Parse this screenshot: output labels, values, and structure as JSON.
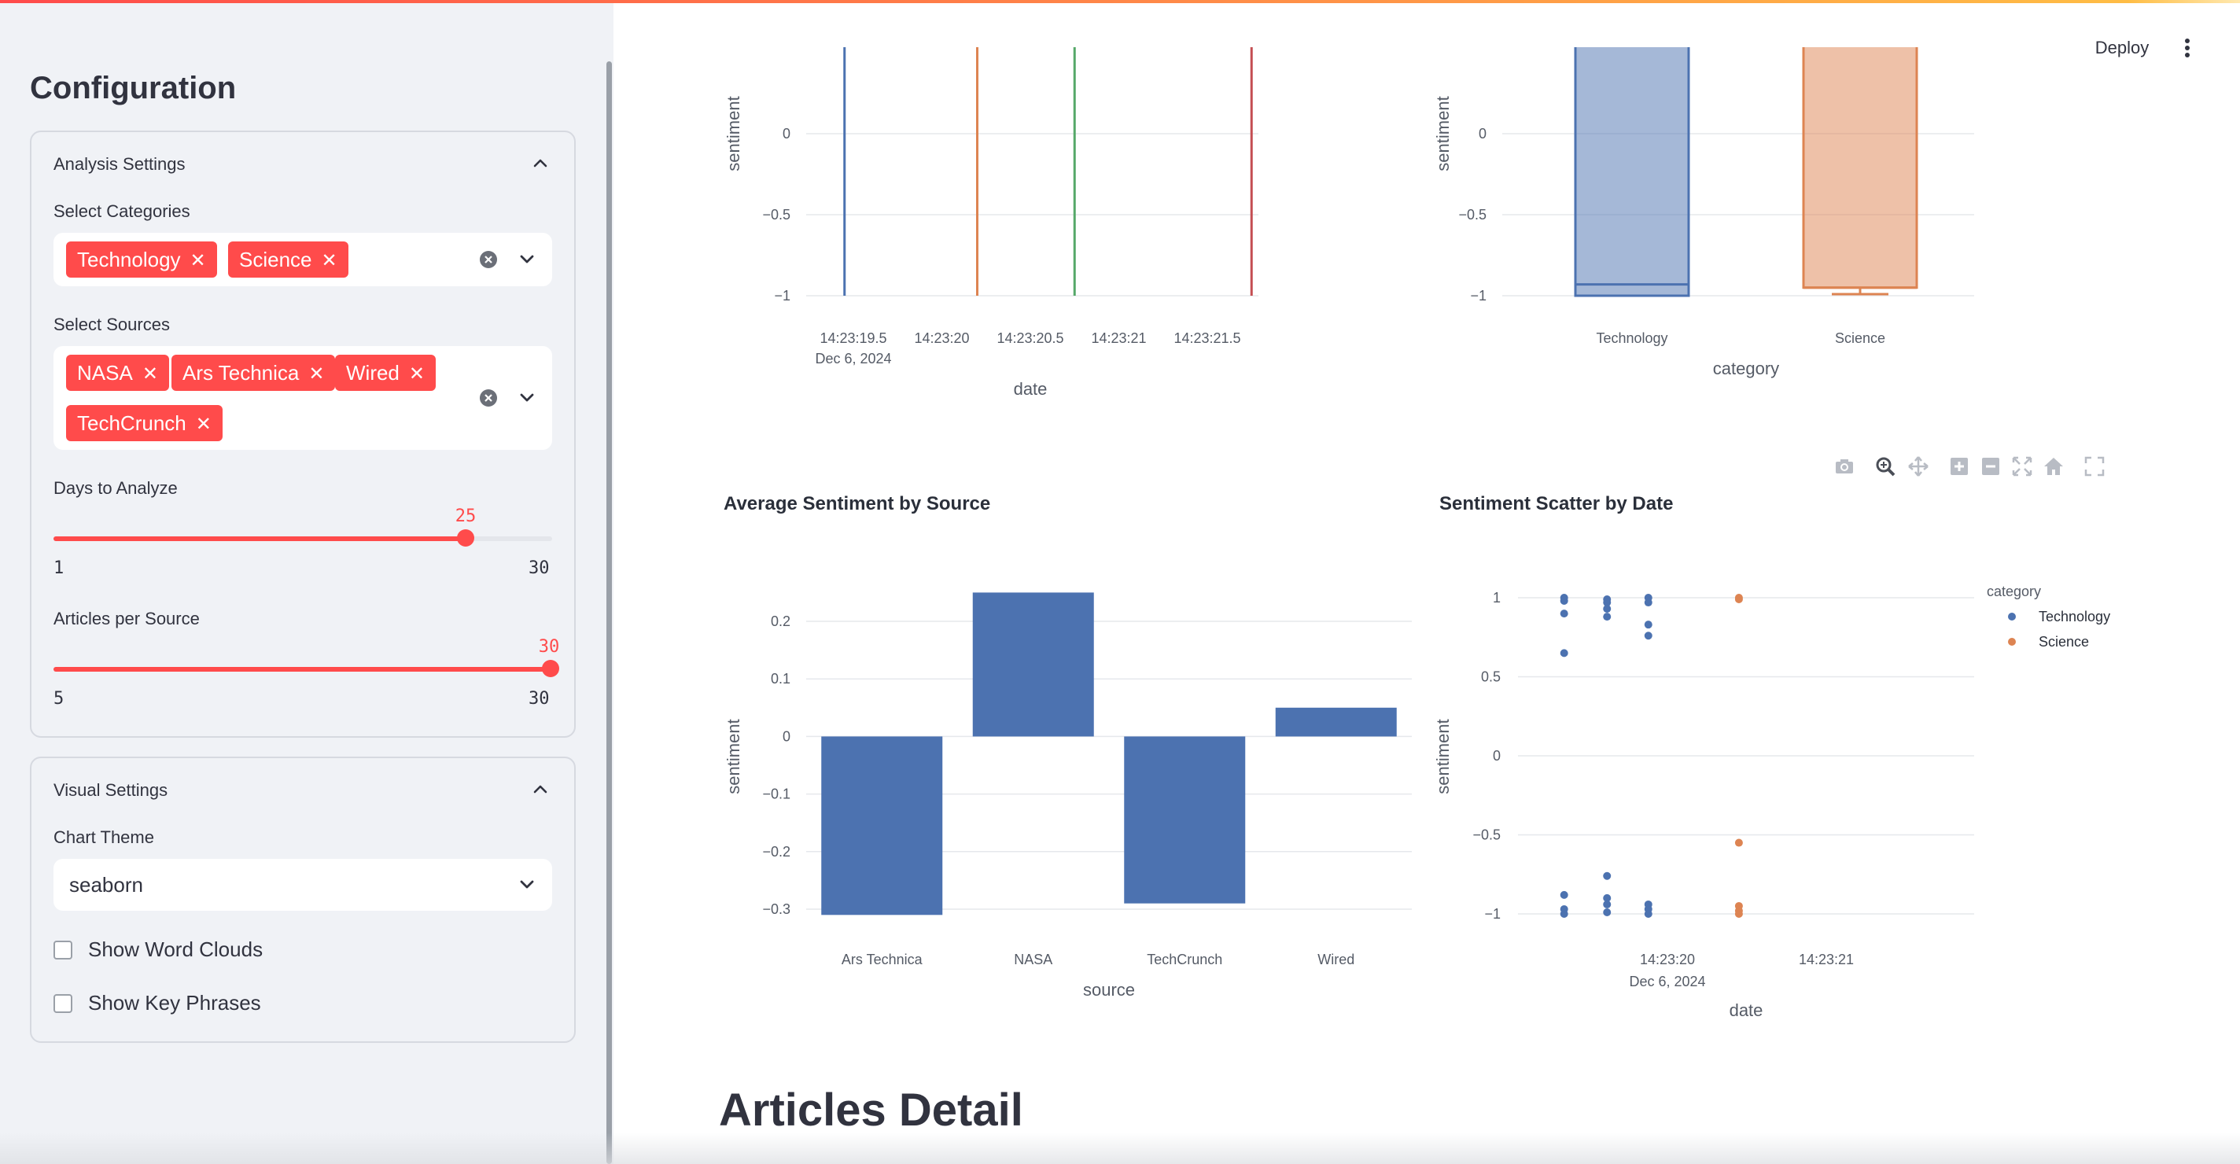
{
  "header": {
    "deploy_label": "Deploy"
  },
  "sidebar": {
    "title": "Configuration",
    "analysis_settings": {
      "title": "Analysis Settings",
      "categories_label": "Select Categories",
      "categories": [
        "Technology",
        "Science"
      ],
      "sources_label": "Select Sources",
      "sources": [
        "NASA",
        "Ars Technica",
        "Wired",
        "TechCrunch"
      ],
      "days": {
        "label": "Days to Analyze",
        "value": "25",
        "min": "1",
        "max": "30"
      },
      "articles": {
        "label": "Articles per Source",
        "value": "30",
        "min": "5",
        "max": "30"
      }
    },
    "visual_settings": {
      "title": "Visual Settings",
      "theme_label": "Chart Theme",
      "theme_value": "seaborn",
      "word_clouds_label": "Show Word Clouds",
      "key_phrases_label": "Show Key Phrases"
    }
  },
  "main": {
    "articles_heading": "Articles Detail"
  },
  "colors": {
    "accent": "#ff4b4b",
    "technology": "#4c72b0",
    "science": "#dd8452",
    "green": "#55a868",
    "red": "#c44e52"
  },
  "chart_data": [
    {
      "type": "line",
      "title": "",
      "xlabel": "date",
      "ylabel": "sentiment",
      "x_ticks": [
        "14:23:19.5",
        "14:23:20",
        "14:23:20.5",
        "14:23:21",
        "14:23:21.5"
      ],
      "x_date_label": "Dec 6, 2024",
      "y_ticks": [
        "0",
        "−0.5",
        "−1"
      ],
      "y_values": [
        0,
        -0.5,
        -1
      ],
      "vertical_lines": [
        {
          "x": 19.45,
          "color": "#4c72b0"
        },
        {
          "x": 20.2,
          "color": "#dd8452"
        },
        {
          "x": 20.75,
          "color": "#55a868"
        },
        {
          "x": 21.75,
          "color": "#c44e52"
        }
      ]
    },
    {
      "type": "box",
      "title": "",
      "xlabel": "category",
      "ylabel": "sentiment",
      "categories": [
        "Technology",
        "Science"
      ],
      "y_ticks": [
        "0",
        "−0.5",
        "−1"
      ],
      "y_values": [
        0,
        -0.5,
        -1
      ],
      "boxes": [
        {
          "category": "Technology",
          "q1": -1.0,
          "median": -0.93,
          "q3": 1.0,
          "min": -1.0,
          "color": "#4c72b0"
        },
        {
          "category": "Science",
          "q1": -0.95,
          "median": -0.95,
          "q3": 1.0,
          "min": -0.99,
          "color": "#dd8452"
        }
      ]
    },
    {
      "type": "bar",
      "title": "Average Sentiment by Source",
      "xlabel": "source",
      "ylabel": "sentiment",
      "categories": [
        "Ars Technica",
        "NASA",
        "TechCrunch",
        "Wired"
      ],
      "values": [
        -0.31,
        0.25,
        -0.29,
        0.05
      ],
      "y_ticks": [
        "0.2",
        "0.1",
        "0",
        "−0.1",
        "−0.2",
        "−0.3"
      ],
      "y_values": [
        0.2,
        0.1,
        0,
        -0.1,
        -0.2,
        -0.3
      ],
      "color": "#4c72b0"
    },
    {
      "type": "scatter",
      "title": "Sentiment Scatter by Date",
      "xlabel": "date",
      "ylabel": "sentiment",
      "x_ticks": [
        "14:23:20",
        "14:23:21"
      ],
      "x_tick_values": [
        20.0,
        21.0
      ],
      "x_date_label": "Dec 6, 2024",
      "y_ticks": [
        "1",
        "0.5",
        "0",
        "−0.5",
        "−1"
      ],
      "y_values": [
        1,
        0.5,
        0,
        -0.5,
        -1
      ],
      "legend_title": "category",
      "legend_position": "top-right",
      "series": [
        {
          "name": "Technology",
          "color": "#4c72b0",
          "points": [
            [
              19.35,
              1.0
            ],
            [
              19.35,
              0.98
            ],
            [
              19.35,
              0.9
            ],
            [
              19.35,
              0.65
            ],
            [
              19.35,
              -0.88
            ],
            [
              19.35,
              -0.97
            ],
            [
              19.35,
              -1.0
            ],
            [
              19.62,
              0.99
            ],
            [
              19.62,
              0.97
            ],
            [
              19.62,
              0.93
            ],
            [
              19.62,
              0.88
            ],
            [
              19.62,
              -0.76
            ],
            [
              19.62,
              -0.9
            ],
            [
              19.62,
              -0.94
            ],
            [
              19.62,
              -0.99
            ],
            [
              19.88,
              1.0
            ],
            [
              19.88,
              0.97
            ],
            [
              19.88,
              0.83
            ],
            [
              19.88,
              0.76
            ],
            [
              19.88,
              -0.94
            ],
            [
              19.88,
              -0.97
            ],
            [
              19.88,
              -1.0
            ]
          ]
        },
        {
          "name": "Science",
          "color": "#dd8452",
          "points": [
            [
              20.45,
              1.0
            ],
            [
              20.45,
              0.99
            ],
            [
              20.45,
              -0.55
            ],
            [
              20.45,
              -0.95
            ],
            [
              20.45,
              -0.98
            ],
            [
              20.45,
              -1.0
            ]
          ]
        }
      ]
    }
  ]
}
